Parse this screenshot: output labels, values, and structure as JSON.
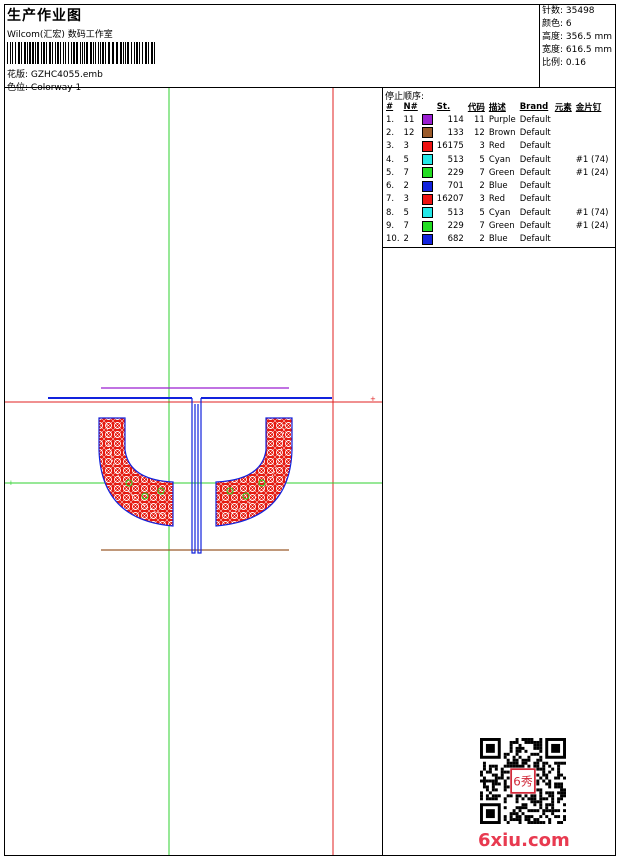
{
  "header": {
    "title": "生产作业图",
    "company": "Wilcom(汇宏) 数码工作室",
    "pattern_label": "花版:",
    "pattern_value": "GZHC4055.emb",
    "colorway_label": "色位:",
    "colorway_value": "Colorway 1"
  },
  "stats": {
    "stitches": "针数: 35498",
    "colors": "颜色: 6",
    "height": "高度: 356.5 mm",
    "width": "宽度: 616.5 mm",
    "scale": "比例: 0.16"
  },
  "sequence": {
    "title": "停止顺序:",
    "headers": {
      "num": "#",
      "needle": "N#",
      "st": "St.",
      "code": "代码",
      "desc": "描述",
      "brand": "Brand",
      "element": "元素",
      "sequin": "金片钉"
    },
    "rows": [
      {
        "num": "1.",
        "needle": "11",
        "st": "114",
        "code": "11",
        "desc": "Purple",
        "brand": "Default",
        "sequin": "",
        "color": "#9b1fd1"
      },
      {
        "num": "2.",
        "needle": "12",
        "st": "133",
        "code": "12",
        "desc": "Brown",
        "brand": "Default",
        "sequin": "",
        "color": "#9a5a2a"
      },
      {
        "num": "3.",
        "needle": "3",
        "st": "16175",
        "code": "3",
        "desc": "Red",
        "brand": "Default",
        "sequin": "",
        "color": "#ee1111"
      },
      {
        "num": "4.",
        "needle": "5",
        "st": "513",
        "code": "5",
        "desc": "Cyan",
        "brand": "Default",
        "sequin": "#1 (74)",
        "color": "#22e8e8"
      },
      {
        "num": "5.",
        "needle": "7",
        "st": "229",
        "code": "7",
        "desc": "Green",
        "brand": "Default",
        "sequin": "#1 (24)",
        "color": "#22dd22"
      },
      {
        "num": "6.",
        "needle": "2",
        "st": "701",
        "code": "2",
        "desc": "Blue",
        "brand": "Default",
        "sequin": "",
        "color": "#1122dd"
      },
      {
        "num": "7.",
        "needle": "3",
        "st": "16207",
        "code": "3",
        "desc": "Red",
        "brand": "Default",
        "sequin": "",
        "color": "#ee1111"
      },
      {
        "num": "8.",
        "needle": "5",
        "st": "513",
        "code": "5",
        "desc": "Cyan",
        "brand": "Default",
        "sequin": "#1 (74)",
        "color": "#22e8e8"
      },
      {
        "num": "9.",
        "needle": "7",
        "st": "229",
        "code": "7",
        "desc": "Green",
        "brand": "Default",
        "sequin": "#1 (24)",
        "color": "#22dd22"
      },
      {
        "num": "10.",
        "needle": "2",
        "st": "682",
        "code": "2",
        "desc": "Blue",
        "brand": "Default",
        "sequin": "",
        "color": "#1122dd"
      }
    ]
  },
  "watermark": "6xiu.com",
  "qr_stamp": "6秀"
}
